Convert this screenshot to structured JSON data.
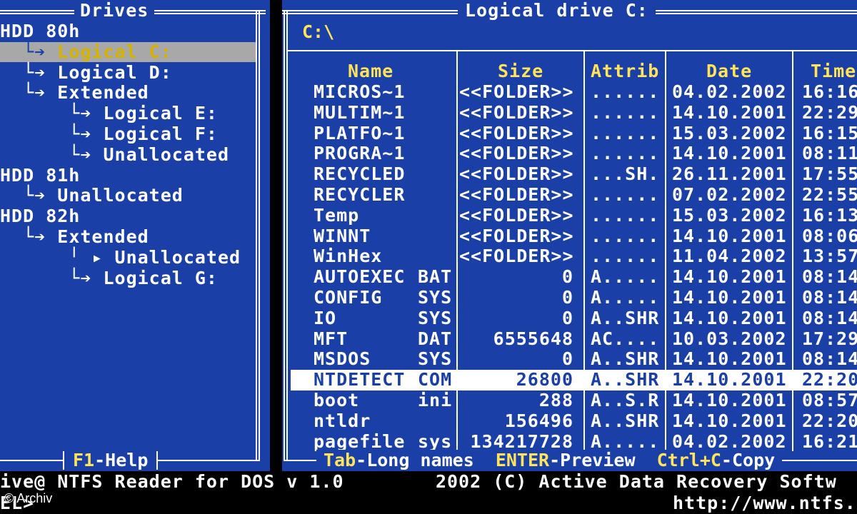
{
  "left_panel": {
    "title": "Drives",
    "tree": [
      {
        "prefix": "",
        "label": "HDD 80h"
      },
      {
        "prefix": "  └➔ ",
        "label": "Logical C:",
        "selected": true
      },
      {
        "prefix": "  └➔ ",
        "label": "Logical D:"
      },
      {
        "prefix": "  └➔ ",
        "label": "Extended"
      },
      {
        "prefix": "      └➔ ",
        "label": "Logical E:"
      },
      {
        "prefix": "      └➔ ",
        "label": "Logical F:"
      },
      {
        "prefix": "      └➔ ",
        "label": "Unallocated"
      },
      {
        "prefix": "",
        "label": "HDD 81h"
      },
      {
        "prefix": "  └➔ ",
        "label": "Unallocated"
      },
      {
        "prefix": "",
        "label": "HDD 82h"
      },
      {
        "prefix": "  └➔ ",
        "label": "Extended"
      },
      {
        "prefix": "      ╵ ▸ ",
        "label": "Unallocated"
      },
      {
        "prefix": "      └➔ ",
        "label": "Logical G:"
      }
    ],
    "footer_key": "F1",
    "footer_text": "-Help"
  },
  "right_panel": {
    "title": "Logical drive C:",
    "path": "C:\\",
    "columns": {
      "name": "Name",
      "size": "Size",
      "attrib": "Attrib",
      "date": "Date",
      "time": "Time"
    },
    "files": [
      {
        "name": "MICROS~1",
        "ext": "",
        "size": "<<FOLDER>>",
        "attrib": "......",
        "date": "04.02.2002",
        "time": "16:16"
      },
      {
        "name": "MULTIM~1",
        "ext": "",
        "size": "<<FOLDER>>",
        "attrib": "......",
        "date": "14.10.2001",
        "time": "22:29"
      },
      {
        "name": "PLATFO~1",
        "ext": "",
        "size": "<<FOLDER>>",
        "attrib": "......",
        "date": "15.03.2002",
        "time": "16:15"
      },
      {
        "name": "PROGRA~1",
        "ext": "",
        "size": "<<FOLDER>>",
        "attrib": "......",
        "date": "14.10.2001",
        "time": "08:11"
      },
      {
        "name": "RECYCLED",
        "ext": "",
        "size": "<<FOLDER>>",
        "attrib": "...SH.",
        "date": "26.11.2001",
        "time": "17:55"
      },
      {
        "name": "RECYCLER",
        "ext": "",
        "size": "<<FOLDER>>",
        "attrib": "......",
        "date": "07.02.2002",
        "time": "22:55"
      },
      {
        "name": "Temp",
        "ext": "",
        "size": "<<FOLDER>>",
        "attrib": "......",
        "date": "15.03.2002",
        "time": "16:13"
      },
      {
        "name": "WINNT",
        "ext": "",
        "size": "<<FOLDER>>",
        "attrib": "......",
        "date": "14.10.2001",
        "time": "08:06"
      },
      {
        "name": "WinHex",
        "ext": "",
        "size": "<<FOLDER>>",
        "attrib": "......",
        "date": "11.04.2002",
        "time": "13:57"
      },
      {
        "name": "AUTOEXEC",
        "ext": "BAT",
        "size": "0",
        "attrib": "A.....",
        "date": "14.10.2001",
        "time": "08:14"
      },
      {
        "name": "CONFIG",
        "ext": "SYS",
        "size": "0",
        "attrib": "A.....",
        "date": "14.10.2001",
        "time": "08:14"
      },
      {
        "name": "IO",
        "ext": "SYS",
        "size": "0",
        "attrib": "A..SHR",
        "date": "14.10.2001",
        "time": "08:14"
      },
      {
        "name": "MFT",
        "ext": "DAT",
        "size": "6555648",
        "attrib": "AC....",
        "date": "10.03.2002",
        "time": "17:29"
      },
      {
        "name": "MSDOS",
        "ext": "SYS",
        "size": "0",
        "attrib": "A..SHR",
        "date": "14.10.2001",
        "time": "08:14"
      },
      {
        "name": "NTDETECT",
        "ext": "COM",
        "size": "26800",
        "attrib": "A..SHR",
        "date": "14.10.2001",
        "time": "22:20",
        "selected": true
      },
      {
        "name": "boot",
        "ext": "ini",
        "size": "288",
        "attrib": "A..S.R",
        "date": "14.10.2001",
        "time": "08:57"
      },
      {
        "name": "ntldr",
        "ext": "",
        "size": "156496",
        "attrib": "A..SHR",
        "date": "14.10.2001",
        "time": "22:20"
      },
      {
        "name": "pagefile",
        "ext": "sys",
        "size": "134217728",
        "attrib": "A.....",
        "date": "04.02.2002",
        "time": "16:21"
      }
    ],
    "footer": [
      {
        "key": "Tab",
        "text": "-Long names  "
      },
      {
        "key": "ENTER",
        "text": "-Preview  "
      },
      {
        "key": "Ctrl+C",
        "text": "-Copy"
      }
    ]
  },
  "status": {
    "line1": "ive@ NTFS Reader for DOS v 1.0        2002 (C) Active Data Recovery Softw",
    "line2": "EL>",
    "line3": "http://www.ntfs.",
    "copyright": "© Archiv"
  },
  "colors": {
    "panel_blue": "#1a3fa6",
    "highlight_yellow": "#ffe45a",
    "selection_gray": "#a8a8a8",
    "text_white": "#ffffff"
  }
}
